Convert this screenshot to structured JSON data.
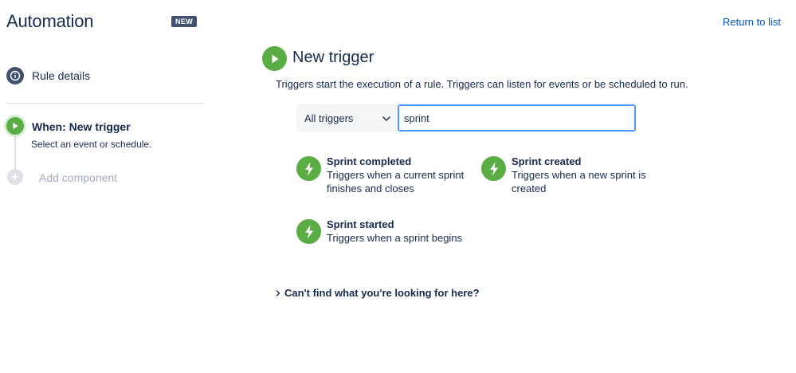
{
  "header": {
    "title": "Automation",
    "badge": "NEW",
    "return_link": "Return to list"
  },
  "sidebar": {
    "rule_details_label": "Rule details",
    "trigger_step": {
      "title": "When: New trigger",
      "subtitle": "Select an event or schedule."
    },
    "add_component_label": "Add component"
  },
  "main": {
    "title": "New trigger",
    "description": "Triggers start the execution of a rule. Triggers can listen for events or be scheduled to run.",
    "filter": {
      "selected": "All triggers"
    },
    "search": {
      "value": "sprint"
    },
    "options": [
      {
        "title": "Sprint completed",
        "description_line1": "Triggers when a current sprint",
        "description_line2": "finishes and closes",
        "icon": "lightning-icon"
      },
      {
        "title": "Sprint created",
        "description_line1": "Triggers when a new sprint is",
        "description_line2": "created",
        "icon": "lightning-icon"
      },
      {
        "title": "Sprint started",
        "description_line1": "Triggers when a sprint begins",
        "description_line2": "",
        "icon": "lightning-icon"
      }
    ],
    "cant_find_label": "Can't find what you're looking for here?"
  },
  "colors": {
    "accent_green": "#5aac44",
    "link_blue": "#0052cc",
    "focus_blue": "#4c9aff",
    "text_primary": "#172b4d",
    "badge_bg": "#42526e"
  }
}
